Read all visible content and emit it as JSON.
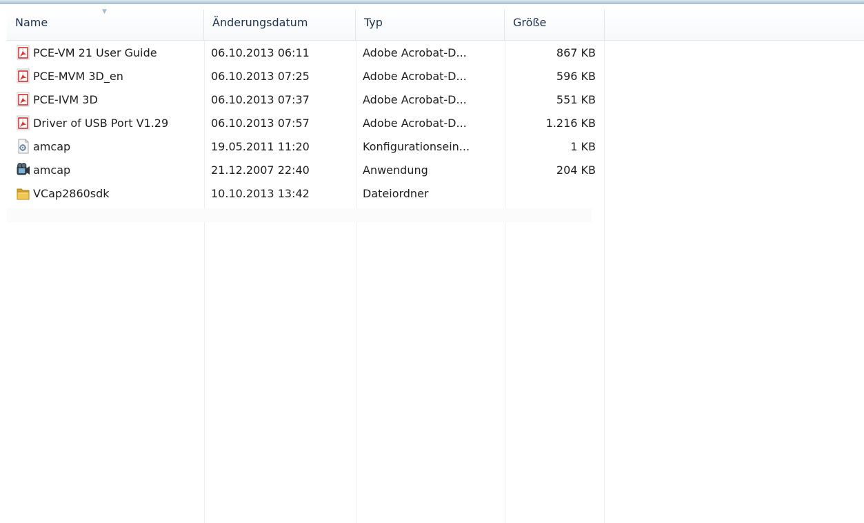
{
  "columns": [
    {
      "label": "Name"
    },
    {
      "label": "Änderungsdatum"
    },
    {
      "label": "Typ"
    },
    {
      "label": "Größe"
    }
  ],
  "files": [
    {
      "name": "PCE-VM 21 User Guide",
      "date": "06.10.2013 06:11",
      "type": "Adobe Acrobat-D...",
      "size": "867 KB",
      "icon": "pdf-icon"
    },
    {
      "name": "PCE-MVM 3D_en",
      "date": "06.10.2013 07:25",
      "type": "Adobe Acrobat-D...",
      "size": "596 KB",
      "icon": "pdf-icon"
    },
    {
      "name": "PCE-IVM 3D",
      "date": "06.10.2013 07:37",
      "type": "Adobe Acrobat-D...",
      "size": "551 KB",
      "icon": "pdf-icon"
    },
    {
      "name": "Driver of USB Port V1.29",
      "date": "06.10.2013 07:57",
      "type": "Adobe Acrobat-D...",
      "size": "1.216 KB",
      "icon": "pdf-icon"
    },
    {
      "name": "amcap",
      "date": "19.05.2011 11:20",
      "type": "Konfigurationsein...",
      "size": "1 KB",
      "icon": "config-file-icon"
    },
    {
      "name": "amcap",
      "date": "21.12.2007 22:40",
      "type": "Anwendung",
      "size": "204 KB",
      "icon": "application-icon"
    },
    {
      "name": "VCap2860sdk",
      "date": "10.10.2013 13:42",
      "type": "Dateiordner",
      "size": "",
      "icon": "folder-icon"
    }
  ]
}
